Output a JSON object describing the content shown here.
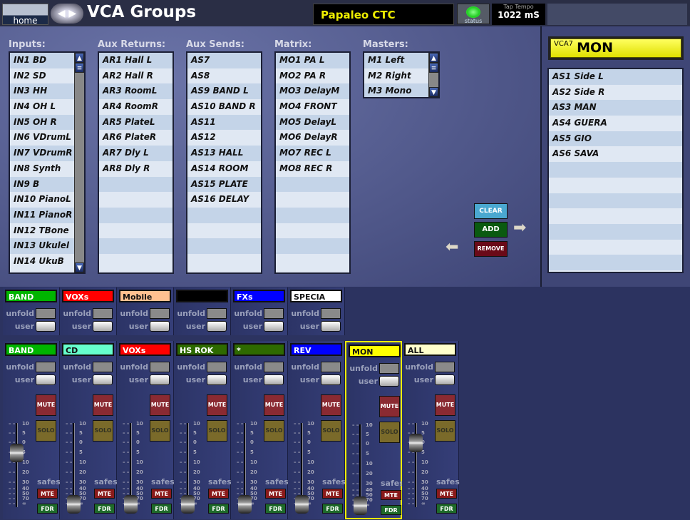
{
  "header": {
    "home": "home",
    "title": "VCA Groups",
    "show": "Papaleo CTC",
    "status": "status",
    "tap_label": "Tap Tempo",
    "tap_value": "1022 mS"
  },
  "lists": [
    {
      "title": "Inputs:",
      "items": [
        "IN1 BD",
        "IN2 SD",
        "IN3 HH",
        "IN4 OH L",
        "IN5 OH R",
        "IN6 VDrumL",
        "IN7 VDrumR",
        "IN8 Synth",
        "IN9 B",
        "IN10 PianoL",
        "IN11 PianoR",
        "IN12 TBone",
        "IN13 Ukulel",
        "IN14 UkuB"
      ],
      "scroll": true
    },
    {
      "title": "Aux Returns:",
      "items": [
        "AR1 Hall L",
        "AR2 Hall R",
        "AR3 RoomL",
        "AR4 RoomR",
        "AR5 PlateL",
        "AR6 PlateR",
        "AR7 Dly L",
        "AR8 Dly R"
      ]
    },
    {
      "title": "Aux Sends:",
      "items": [
        "AS7",
        "AS8",
        "AS9 BAND L",
        "AS10 BAND R",
        "AS11",
        "AS12",
        "AS13 HALL",
        "AS14 ROOM",
        "AS15 PLATE",
        "AS16 DELAY"
      ]
    },
    {
      "title": "Matrix:",
      "items": [
        "MO1 PA L",
        "MO2 PA R",
        "MO3 DelayM",
        "MO4 FRONT",
        "MO5 DelayL",
        "MO6 DelayR",
        "MO7 REC L",
        "MO8 REC R"
      ]
    },
    {
      "title": "Masters:",
      "items": [
        "M1 Left",
        "M2 Right",
        "M3 Mono"
      ],
      "scroll": true
    }
  ],
  "actions": {
    "clear": "CLEAR",
    "add": "ADD",
    "remove": "REMOVE"
  },
  "vca": {
    "number": "VCA7",
    "name": "MON",
    "members": [
      "AS1 Side L",
      "AS2 Side R",
      "AS3 MAN",
      "AS4 GUERA",
      "AS5 GIO",
      "AS6 SAVA"
    ]
  },
  "labels": {
    "unfold": "unfold",
    "user": "user",
    "mute": "MUTE",
    "solo": "SOLO",
    "safes": "safes",
    "mte": "MTE",
    "fdr": "FDR"
  },
  "fader_scale": [
    "10",
    "5",
    "0",
    "5",
    "10",
    "20",
    "30",
    "40",
    "50",
    "70",
    "∞"
  ],
  "top_strips": [
    {
      "name": "BAND",
      "color": "#00b400",
      "text": "#fff"
    },
    {
      "name": "VOXs",
      "color": "#ff0000",
      "text": "#fff"
    },
    {
      "name": "Mobile",
      "color": "#ffc090",
      "text": "#111"
    },
    {
      "name": "",
      "color": "#000000",
      "text": "#fff"
    },
    {
      "name": "FXs",
      "color": "#0000ff",
      "text": "#fff"
    },
    {
      "name": "SPECIA",
      "color": "#ffffff",
      "text": "#111"
    }
  ],
  "vca_strips": [
    {
      "name": "BAND",
      "color": "#00b400",
      "text": "#fff",
      "fader": "-5"
    },
    {
      "name": "CD",
      "color": "#66ffcc",
      "text": "#111",
      "fader": "-∞"
    },
    {
      "name": "VOXs",
      "color": "#ff0000",
      "text": "#fff",
      "fader": "-∞"
    },
    {
      "name": "HS ROK",
      "color": "#2e6a00",
      "text": "#fff",
      "fader": "-∞"
    },
    {
      "name": "*",
      "color": "#2e6a00",
      "text": "#fff",
      "fader": "-∞"
    },
    {
      "name": "REV",
      "color": "#0000ff",
      "text": "#fff",
      "fader": "-∞"
    },
    {
      "name": "MON",
      "color": "#ffff00",
      "text": "#111",
      "fader": "-∞",
      "selected": true
    },
    {
      "name": "ALL",
      "color": "#ffffcc",
      "text": "#111",
      "fader": "0"
    }
  ]
}
